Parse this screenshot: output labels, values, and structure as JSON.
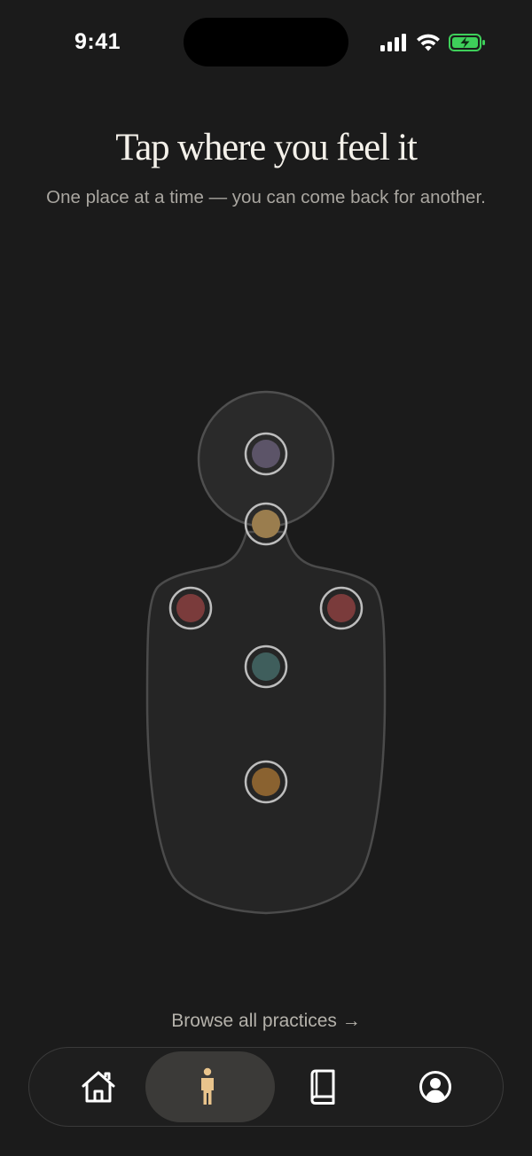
{
  "status_bar": {
    "time": "9:41",
    "battery_color": "#3ecf5a"
  },
  "header": {
    "title": "Tap where you feel it",
    "subtitle": "One place at a time — you can come back for another."
  },
  "body_map": {
    "points": [
      {
        "id": "head",
        "color": "#5c5468"
      },
      {
        "id": "throat",
        "color": "#9a7d4e"
      },
      {
        "id": "left-shoulder",
        "color": "#7a3b3b"
      },
      {
        "id": "right-shoulder",
        "color": "#7a3b3b"
      },
      {
        "id": "chest",
        "color": "#3f5e5c"
      },
      {
        "id": "belly",
        "color": "#8a6230"
      }
    ]
  },
  "browse_link": "Browse all practices →",
  "tab_bar": {
    "accent": "#e9c48c",
    "tabs": [
      {
        "name": "home",
        "icon": "home-icon",
        "active": false
      },
      {
        "name": "body",
        "icon": "body-icon",
        "active": true
      },
      {
        "name": "library",
        "icon": "book-icon",
        "active": false
      },
      {
        "name": "profile",
        "icon": "profile-icon",
        "active": false
      }
    ]
  }
}
